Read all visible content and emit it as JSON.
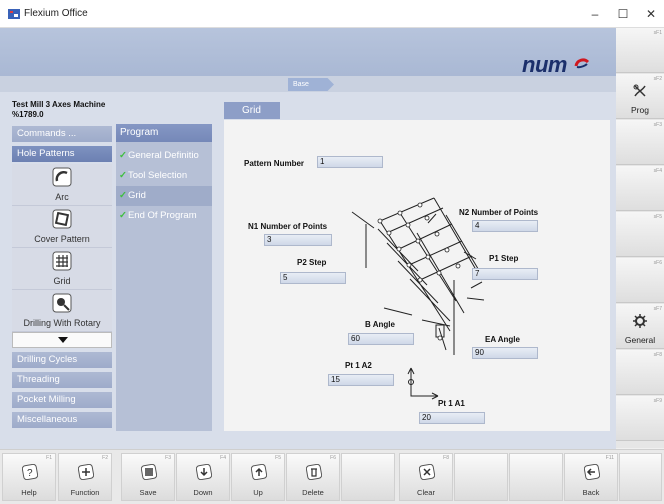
{
  "window": {
    "title": "Flexium Office",
    "minimize": "–",
    "maximize": "☐",
    "close": "✕"
  },
  "brand": {
    "logo_text": "num"
  },
  "breadcrumb": "Base",
  "machine": {
    "name": "Test Mill 3 Axes Machine",
    "program": "%1789.0"
  },
  "left_panel": {
    "commands": "Commands ...",
    "hole_patterns": "Hole Patterns",
    "icons": [
      {
        "label": "Arc",
        "icon": "arc-icon"
      },
      {
        "label": "Cover Pattern",
        "icon": "cover-pattern-icon"
      },
      {
        "label": "Grid",
        "icon": "grid-icon"
      },
      {
        "label": "Drilling With Rotary",
        "icon": "drilling-rotary-icon"
      }
    ],
    "categories": [
      "Drilling Cycles",
      "Threading",
      "Pocket Milling",
      "Miscellaneous"
    ]
  },
  "program": {
    "header": "Program",
    "steps": [
      "General Definitio",
      "Tool Selection",
      "Grid",
      "End Of Program"
    ],
    "check": "✓"
  },
  "grid_form": {
    "tab": "Grid",
    "pattern_number": {
      "label": "Pattern Number",
      "value": "1"
    },
    "n1": {
      "label": "N1 Number of Points",
      "value": "3"
    },
    "n2": {
      "label": "N2 Number of Points",
      "value": "4"
    },
    "p2": {
      "label": "P2 Step",
      "value": "5"
    },
    "p1": {
      "label": "P1 Step",
      "value": "7"
    },
    "b_angle": {
      "label": "B Angle",
      "value": "60"
    },
    "ea_angle": {
      "label": "EA Angle",
      "value": "90"
    },
    "pt1a2": {
      "label": "Pt 1 A2",
      "value": "15"
    },
    "pt1a1": {
      "label": "Pt 1 A1",
      "value": "20"
    }
  },
  "right_softkeys": [
    {
      "key": "sF1",
      "label": ""
    },
    {
      "key": "sF2",
      "label": "Prog"
    },
    {
      "key": "sF3",
      "label": ""
    },
    {
      "key": "sF4",
      "label": ""
    },
    {
      "key": "sF5",
      "label": ""
    },
    {
      "key": "sF6",
      "label": ""
    },
    {
      "key": "sF7",
      "label": "General"
    },
    {
      "key": "sF8",
      "label": ""
    },
    {
      "key": "sF9",
      "label": ""
    }
  ],
  "bottom_softkeys": [
    {
      "key": "F1",
      "label": "Help"
    },
    {
      "key": "F2",
      "label": "Function"
    },
    {
      "key": "F3",
      "label": "Save"
    },
    {
      "key": "F4",
      "label": "Down"
    },
    {
      "key": "F5",
      "label": "Up"
    },
    {
      "key": "F6",
      "label": "Delete"
    },
    {
      "key": "",
      "label": ""
    },
    {
      "key": "F8",
      "label": "Clear"
    },
    {
      "key": "",
      "label": ""
    },
    {
      "key": "",
      "label": ""
    },
    {
      "key": "F11",
      "label": "Back"
    },
    {
      "key": "",
      "label": ""
    }
  ],
  "colors": {
    "accent": "#8597c4",
    "check": "#3fbf3f",
    "logo": "#1b2f6b",
    "logo_mark": "#d0181f"
  }
}
